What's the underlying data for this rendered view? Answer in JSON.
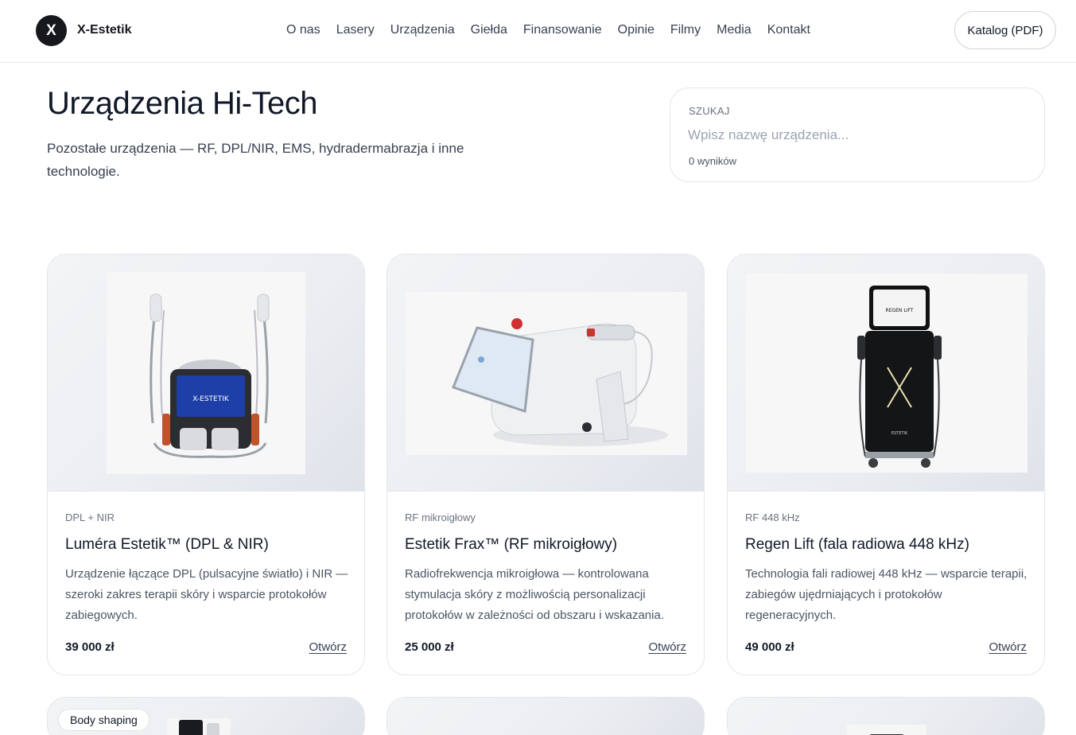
{
  "header": {
    "logo_letter": "X",
    "brand": "X-Estetik",
    "nav": [
      "O nas",
      "Lasery",
      "Urządzenia",
      "Giełda",
      "Finansowanie",
      "Opinie",
      "Filmy",
      "Media",
      "Kontakt"
    ],
    "catalog_button": "Katalog (PDF)"
  },
  "hero": {
    "title": "Urządzenia Hi-Tech",
    "subtitle": "Pozostałe urządzenia — RF, DPL/NIR, EMS, hydradermabrazja i inne technologie."
  },
  "search": {
    "label": "SZUKAJ",
    "placeholder": "Wpisz nazwę urządzenia...",
    "count": "0 wyników"
  },
  "products": [
    {
      "tag": "DPL + NIR",
      "name": "Luméra Estetik™ (DPL & NIR)",
      "description": "Urządzenie łączące DPL (pulsacyjne światło) i NIR — szeroki zakres terapii skóry i wsparcie protokołów zabiegowych.",
      "price": "39 000 zł",
      "open": "Otwórz",
      "screen_text": "X-ESTETIK"
    },
    {
      "tag": "RF mikroigłowy",
      "name": "Estetik Frax™ (RF mikroigłowy)",
      "description": "Radiofrekwencja mikroigłowa — kontrolowana stymulacja skóry z możliwością personalizacji protokołów w zależności od obszaru i wskazania.",
      "price": "25 000 zł",
      "open": "Otwórz"
    },
    {
      "tag": "RF 448 kHz",
      "name": "Regen Lift (fala radiowa 448 kHz)",
      "description": "Technologia fali radiowej 448 kHz — wsparcie terapii, zabiegów ujędrniających i protokołów regeneracyjnych.",
      "price": "49 000 zł",
      "open": "Otwórz",
      "screen_text": "REGEN LIFT",
      "body_text": "ESTETIK"
    }
  ],
  "next_row": {
    "badge": "Body shaping"
  }
}
